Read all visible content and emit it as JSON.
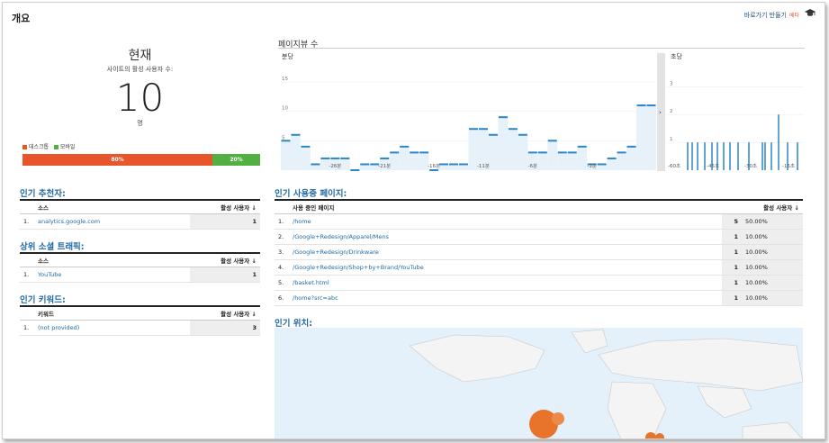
{
  "page": {
    "title": "개요",
    "shortcut": "바로가기 만들기",
    "beta": "베타",
    "cap_icon": "graduation-cap-icon"
  },
  "now": {
    "heading": "현재",
    "subtitle": "사이트의 활성 사용자 수:",
    "count": "10",
    "unit": "명"
  },
  "device": {
    "desktop_label": "데스크톱",
    "mobile_label": "모바일",
    "desktop_pct": 80,
    "mobile_pct": 20,
    "desktop_text": "80%",
    "mobile_text": "20%",
    "desktop_color": "#e8552a",
    "mobile_color": "#52b043"
  },
  "referrers": {
    "title": "인기 추천자:",
    "col_source": "소스",
    "col_users": "활성 사용자",
    "rows": [
      {
        "idx": "1.",
        "name": "analytics.google.com",
        "value": "1"
      }
    ]
  },
  "social": {
    "title": "상위 소셜 트래픽:",
    "col_source": "소스",
    "col_users": "활성 사용자",
    "rows": [
      {
        "idx": "1.",
        "name": "YouTube",
        "value": "1"
      }
    ]
  },
  "keywords": {
    "title": "인기 키워드:",
    "col_source": "키워드",
    "col_users": "활성 사용자",
    "rows": [
      {
        "idx": "1.",
        "name": "(not provided)",
        "value": "3"
      }
    ]
  },
  "pageviews": {
    "title": "페이지뷰 수",
    "min_label": "분당",
    "sec_label": "초당"
  },
  "chart_data": [
    {
      "type": "bar",
      "title": "분당",
      "yticks": [
        "15",
        "10",
        "5"
      ],
      "ylim": [
        0,
        15
      ],
      "x_labels": [
        "-26분",
        "-21분",
        "-16분",
        "-11분",
        "-6분",
        "-1분"
      ],
      "values": [
        5,
        6,
        4,
        1,
        2,
        2,
        2,
        0,
        1,
        1,
        2,
        3,
        4,
        3,
        3,
        0,
        1,
        1,
        1,
        7,
        7,
        6,
        9,
        7,
        6,
        3,
        3,
        5,
        3,
        3,
        4,
        1,
        1,
        2,
        3,
        4,
        11,
        11
      ]
    },
    {
      "type": "bar",
      "title": "초당",
      "yticks": [
        "3",
        "2",
        "1"
      ],
      "ylim": [
        0,
        3
      ],
      "x_labels": [
        "-60초",
        "-45초",
        "-30초",
        "-15초"
      ],
      "values": [
        1,
        1,
        1,
        1,
        1,
        1,
        1,
        1,
        1,
        1,
        1,
        1,
        1,
        2,
        1,
        1
      ]
    }
  ],
  "pages": {
    "title": "인기 사용중 페이지:",
    "col_page": "사용 중인 페이지",
    "col_users": "활성 사용자",
    "rows": [
      {
        "idx": "1.",
        "path": "/home",
        "value": "5",
        "pct": "50.00%"
      },
      {
        "idx": "2.",
        "path": "/Google+Redesign/Apparel/Mens",
        "value": "1",
        "pct": "10.00%"
      },
      {
        "idx": "3.",
        "path": "/Google+Redesign/Drinkware",
        "value": "1",
        "pct": "10.00%"
      },
      {
        "idx": "4.",
        "path": "/Google+Redesign/Shop+by+Brand/YouTube",
        "value": "1",
        "pct": "10.00%"
      },
      {
        "idx": "5.",
        "path": "/basket.html",
        "value": "1",
        "pct": "10.00%"
      },
      {
        "idx": "6.",
        "path": "/home?src=abc",
        "value": "1",
        "pct": "10.00%"
      }
    ]
  },
  "locations": {
    "title": "인기 위치:"
  }
}
